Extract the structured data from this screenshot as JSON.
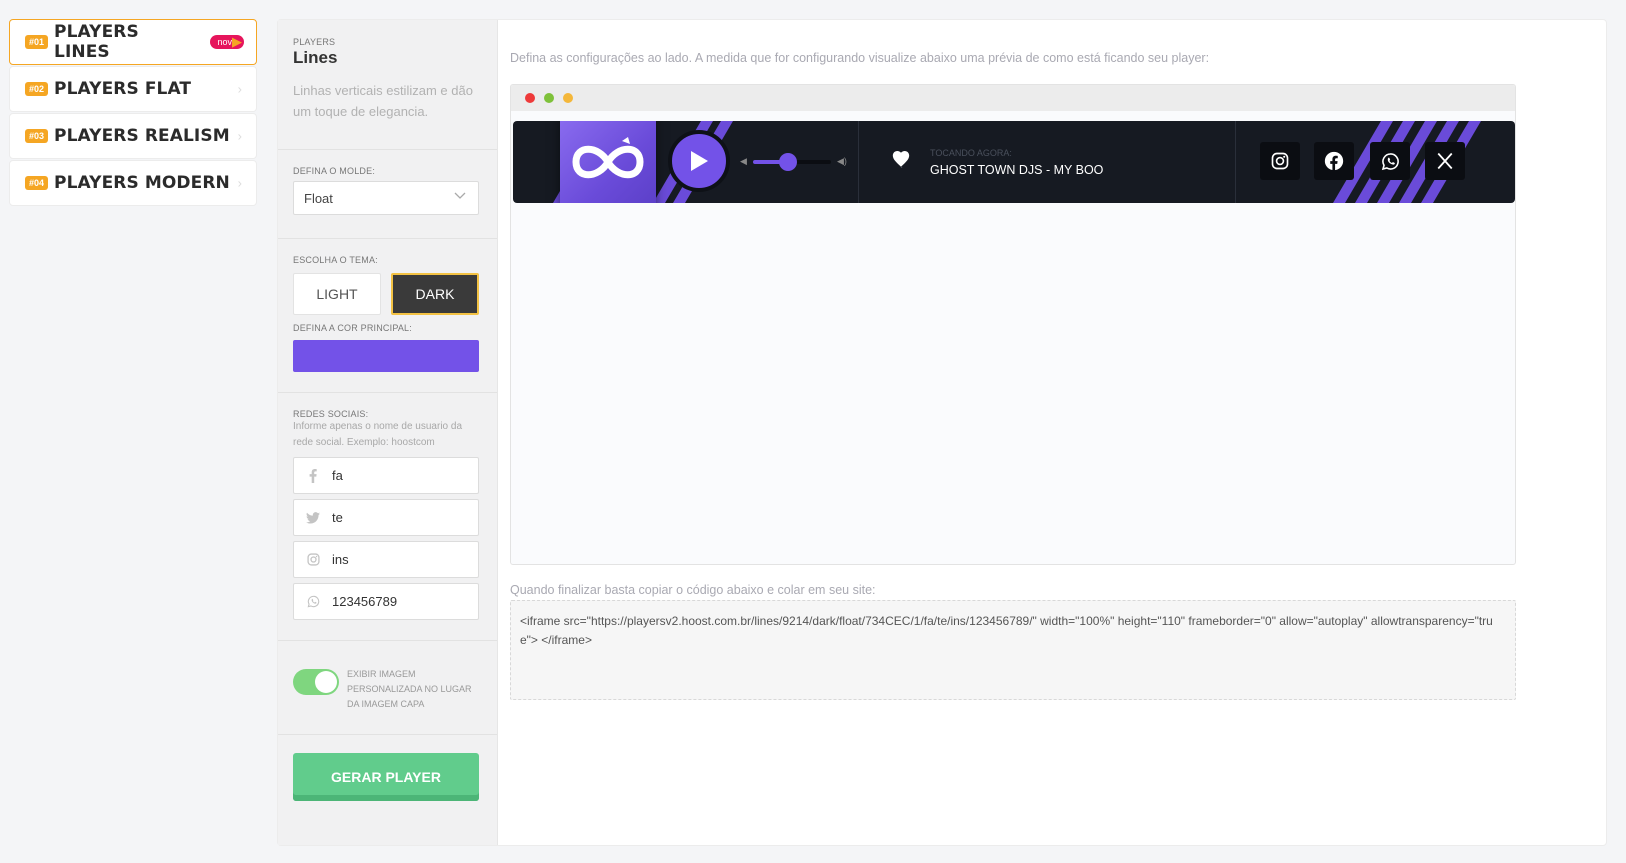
{
  "nav": {
    "items": [
      {
        "num": "#01",
        "label": "PLAYERS LINES",
        "badge": "novo"
      },
      {
        "num": "#02",
        "label": "PLAYERS FLAT"
      },
      {
        "num": "#03",
        "label": "PLAYERS REALISM"
      },
      {
        "num": "#04",
        "label": "PLAYERS MODERN"
      }
    ],
    "active_index": 0
  },
  "panel": {
    "category": "PLAYERS",
    "title": "Lines",
    "description": "Linhas verticais estilizam e dão um toque de elegancia.",
    "mold_label": "DEFINA O MOLDE:",
    "mold_value": "Float",
    "theme_label": "ESCOLHA O TEMA:",
    "theme_light": "LIGHT",
    "theme_dark": "DARK",
    "theme_selected": "DARK",
    "color_label": "DEFINA A COR PRINCIPAL:",
    "color_value": "#7352E8",
    "social_label": "REDES SOCIAIS:",
    "social_help": "Informe apenas o nome de usuario da rede social. Exemplo: hoostcom",
    "social_inputs": [
      {
        "icon": "facebook-icon",
        "value": "fa"
      },
      {
        "icon": "twitter-icon",
        "value": "te"
      },
      {
        "icon": "instagram-icon",
        "value": "ins"
      },
      {
        "icon": "whatsapp-icon",
        "value": "123456789"
      }
    ],
    "toggle_on": true,
    "toggle_label": "EXIBIR IMAGEM PERSONALIZADA NO LUGAR DA IMAGEM CAPA",
    "generate_button": "GERAR PLAYER"
  },
  "preview": {
    "intro": "Defina as configurações ao lado. A medida que for configurando visualize abaixo uma prévia de como está ficando seu player:",
    "player": {
      "now_playing_label": "TOCANDO AGORA:",
      "track": "GHOST TOWN DJS - MY BOO",
      "volume_fraction": 0.45,
      "social_icons": [
        "instagram-icon",
        "facebook-icon",
        "whatsapp-icon",
        "x-icon"
      ]
    }
  },
  "code": {
    "label": "Quando finalizar basta copiar o código abaixo e colar em seu site:",
    "snippet": "<iframe src=\"https://playersv2.hoost.com.br/lines/9214/dark/float/734CEC/1/fa/te/ins/123456789/\" width=\"100%\" height=\"110\" frameborder=\"0\" allow=\"autoplay\" allowtransparency=\"true\"> </iframe>"
  },
  "colors": {
    "accent": "#f5a623",
    "primary": "#7352e8",
    "badge": "#e6155c",
    "success": "#61cc8c",
    "player_bg": "#161a22"
  }
}
